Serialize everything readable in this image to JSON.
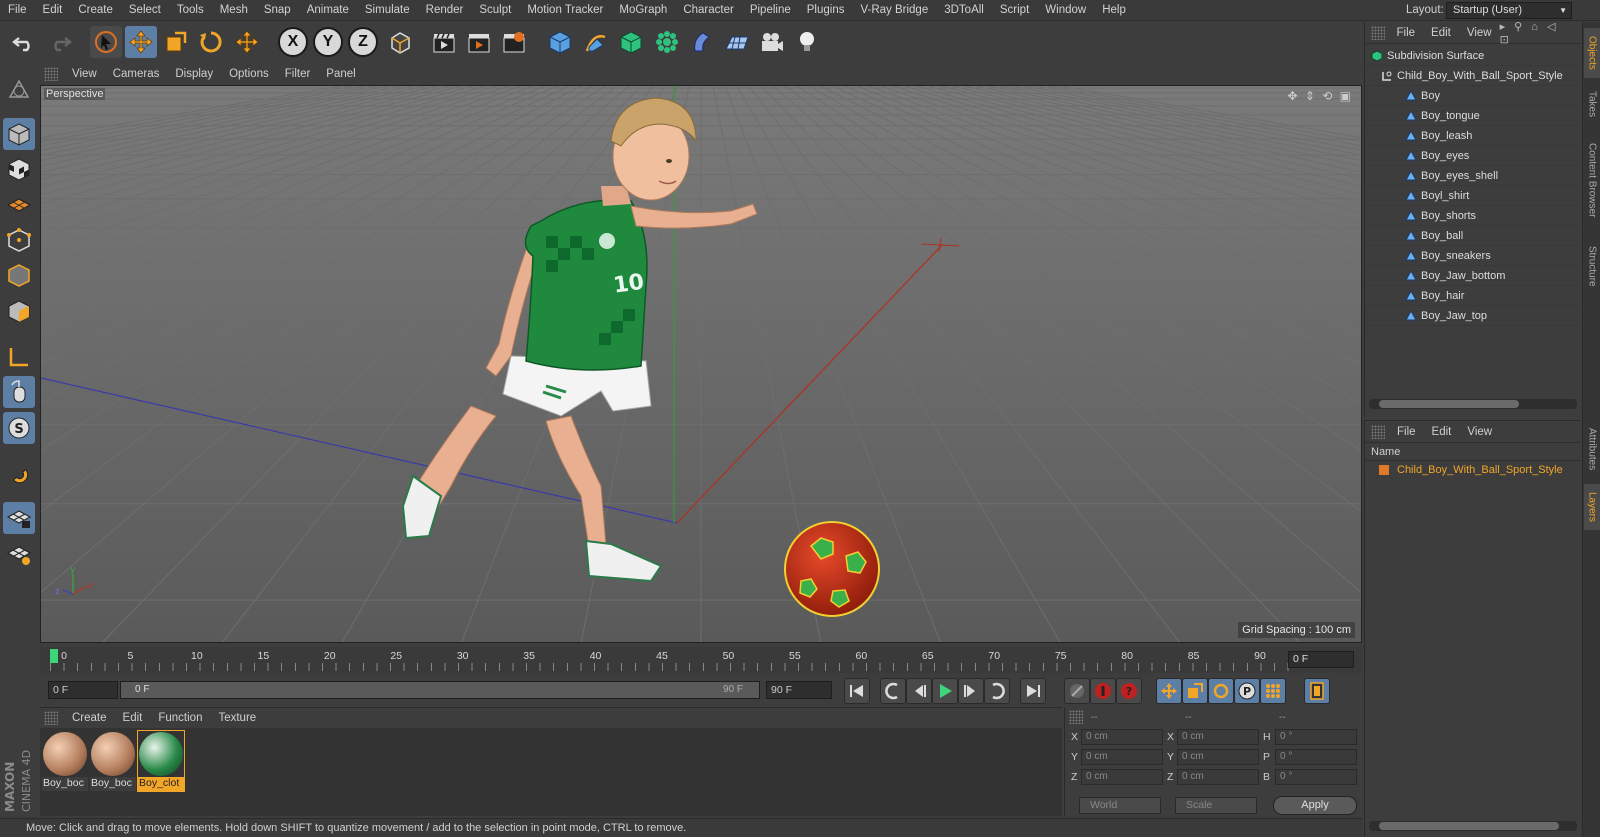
{
  "menubar": {
    "items": [
      "File",
      "Edit",
      "Create",
      "Select",
      "Tools",
      "Mesh",
      "Snap",
      "Animate",
      "Simulate",
      "Render",
      "Sculpt",
      "Motion Tracker",
      "MoGraph",
      "Character",
      "Pipeline",
      "Plugins",
      "V-Ray Bridge",
      "3DToAll",
      "Script",
      "Window",
      "Help"
    ],
    "layout_label": "Layout:",
    "layout_value": "Startup (User)"
  },
  "viewport": {
    "menu": [
      "View",
      "Cameras",
      "Display",
      "Options",
      "Filter",
      "Panel"
    ],
    "camera_label": "Perspective",
    "grid_spacing": "Grid Spacing : 100 cm"
  },
  "timeline": {
    "ticks": [
      "0",
      "5",
      "10",
      "15",
      "20",
      "25",
      "30",
      "35",
      "40",
      "45",
      "50",
      "55",
      "60",
      "65",
      "70",
      "75",
      "80",
      "85",
      "90"
    ],
    "current_frame": "0 F"
  },
  "transport": {
    "start_field": "0 F",
    "slider_left": "0 F",
    "slider_right": "90 F",
    "end_field": "90 F"
  },
  "materials": {
    "menu": [
      "Create",
      "Edit",
      "Function",
      "Texture"
    ],
    "items": [
      {
        "label": "Boy_boc"
      },
      {
        "label": "Boy_boc"
      },
      {
        "label": "Boy_clot"
      }
    ]
  },
  "coords": {
    "headers": [
      "--",
      "--",
      "--"
    ],
    "rows": [
      {
        "a": "X",
        "v1": "0 cm",
        "b": "X",
        "v2": "0 cm",
        "c": "H",
        "v3": "0 °"
      },
      {
        "a": "Y",
        "v1": "0 cm",
        "b": "Y",
        "v2": "0 cm",
        "c": "P",
        "v3": "0 °"
      },
      {
        "a": "Z",
        "v1": "0 cm",
        "b": "Z",
        "v2": "0 cm",
        "c": "B",
        "v3": "0 °"
      }
    ],
    "space": "World",
    "mode": "Scale",
    "apply": "Apply"
  },
  "status": "Move: Click and drag to move elements. Hold down SHIFT to quantize movement / add to the selection in point mode, CTRL to remove.",
  "objects": {
    "menu": [
      "File",
      "Edit",
      "View"
    ],
    "tree": [
      {
        "label": "Subdivision Surface",
        "type": "subdiv"
      },
      {
        "label": "Child_Boy_With_Ball_Sport_Style",
        "type": "null"
      },
      {
        "label": "Boy",
        "type": "mesh"
      },
      {
        "label": "Boy_tongue",
        "type": "mesh"
      },
      {
        "label": "Boy_leash",
        "type": "mesh"
      },
      {
        "label": "Boy_eyes",
        "type": "mesh"
      },
      {
        "label": "Boy_eyes_shell",
        "type": "mesh"
      },
      {
        "label": "Boyl_shirt",
        "type": "mesh"
      },
      {
        "label": "Boy_shorts",
        "type": "mesh"
      },
      {
        "label": "Boy_ball",
        "type": "mesh"
      },
      {
        "label": "Boy_sneakers",
        "type": "mesh"
      },
      {
        "label": "Boy_Jaw_bottom",
        "type": "mesh"
      },
      {
        "label": "Boy_hair",
        "type": "mesh"
      },
      {
        "label": "Boy_Jaw_top",
        "type": "mesh"
      }
    ]
  },
  "layers": {
    "menu": [
      "File",
      "Edit",
      "View"
    ],
    "column": "Name",
    "items": [
      "Child_Boy_With_Ball_Sport_Style"
    ]
  },
  "side_tabs": [
    "Objects",
    "Takes",
    "Content Browser",
    "Structure",
    "Attributes",
    "Layers"
  ],
  "logo": {
    "line1": "MAXON",
    "line2": "CINEMA 4D"
  }
}
